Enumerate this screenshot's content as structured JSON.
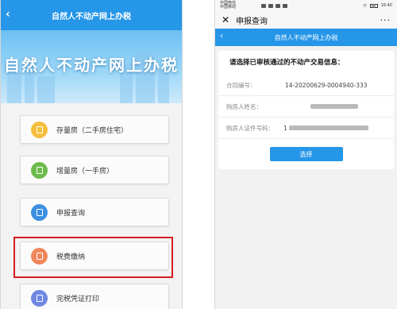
{
  "left": {
    "header_title": "自然人不动产网上办税",
    "back_icon": "‹",
    "banner_title": "自然人不动产网上办税",
    "menu": [
      {
        "label": "存量房（二手房住宅）",
        "icon": "house-icon",
        "color": "#f5bf3d"
      },
      {
        "label": "增量房（一手房）",
        "icon": "building-icon",
        "color": "#6dbb4d"
      },
      {
        "label": "申报查询",
        "icon": "document-search-icon",
        "color": "#3d8fe0"
      },
      {
        "label": "税费缴纳",
        "icon": "tax-payment-icon",
        "color": "#f0875b"
      },
      {
        "label": "完税凭证打印",
        "icon": "print-icon",
        "color": "#7087e2"
      }
    ],
    "highlight_color": "#d81e1e"
  },
  "right": {
    "status": {
      "carrier_line1": "中国电信",
      "carrier_line2": "中国移动",
      "time": "16:40"
    },
    "window_title": "申报查询",
    "close_icon": "✕",
    "more_icon": "···",
    "header_title": "自然人不动产网上办税",
    "back_icon": "‹",
    "prompt": "请选择已审核通过的不动产交易信息：",
    "fields": [
      {
        "label": "合同编号：",
        "value": "14-20200629-0004940-333"
      },
      {
        "label": "购房人姓名：",
        "value": ""
      },
      {
        "label": "购房人证件号码：",
        "value": "1"
      }
    ],
    "select_button": "选择"
  },
  "colors": {
    "brand_blue": "#2596e8"
  }
}
